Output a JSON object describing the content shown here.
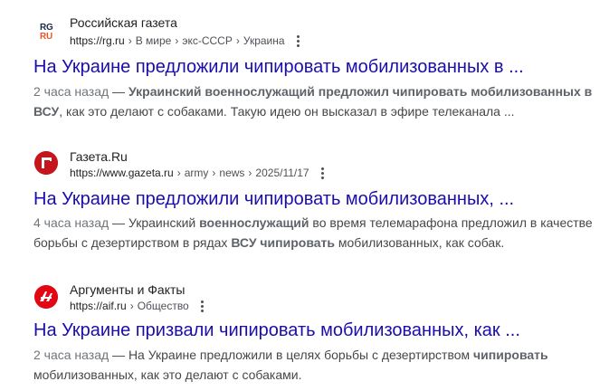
{
  "results": [
    {
      "favicon": "rg-ru-logo-icon",
      "site_name": "Российская газета",
      "url_host": "https://rg.ru",
      "url_path": [
        "В мире",
        "экс-СССР",
        "Украина"
      ],
      "title": "На Украине предложили чипировать мобилизованных в ...",
      "date": "2 часа назад",
      "snippet_parts": [
        {
          "text": " — ",
          "bold": false
        },
        {
          "text": "Украинский военнослужащий",
          "bold": true
        },
        {
          "text": " ",
          "bold": false
        },
        {
          "text": "предложил чипировать мобилизованных в ВСУ",
          "bold": true
        },
        {
          "text": ", как это делают с собаками. Такую идею он высказал в эфире телеканала ...",
          "bold": false
        }
      ]
    },
    {
      "favicon": "gazeta-ru-logo-icon",
      "site_name": "Газета.Ru",
      "url_host": "https://www.gazeta.ru",
      "url_path": [
        "army",
        "news",
        "2025/11/17"
      ],
      "title": "На Украине предложили чипировать мобилизованных, ...",
      "date": "4 часа назад",
      "snippet_parts": [
        {
          "text": " — Украинский ",
          "bold": false
        },
        {
          "text": "военнослужащий",
          "bold": true
        },
        {
          "text": " во время телемарафона предложил в качестве борьбы с дезертирством в рядах ",
          "bold": false
        },
        {
          "text": "ВСУ чипировать",
          "bold": true
        },
        {
          "text": " мобилизованных, как собак.",
          "bold": false
        }
      ]
    },
    {
      "favicon": "aif-ru-logo-icon",
      "site_name": "Аргументы и Факты",
      "url_host": "https://aif.ru",
      "url_path": [
        "Общество"
      ],
      "title": "На Украине призвали чипировать мобилизованных, как ...",
      "date": "2 часа назад",
      "snippet_parts": [
        {
          "text": " — На Украине предложили в целях борьбы с дезертирством ",
          "bold": false
        },
        {
          "text": "чипировать",
          "bold": true
        },
        {
          "text": " мобилизованных, как это делают с собаками.",
          "bold": false
        }
      ]
    }
  ],
  "colors": {
    "link": "#1a0dab",
    "url": "#4d5156",
    "snippet": "#474747"
  }
}
